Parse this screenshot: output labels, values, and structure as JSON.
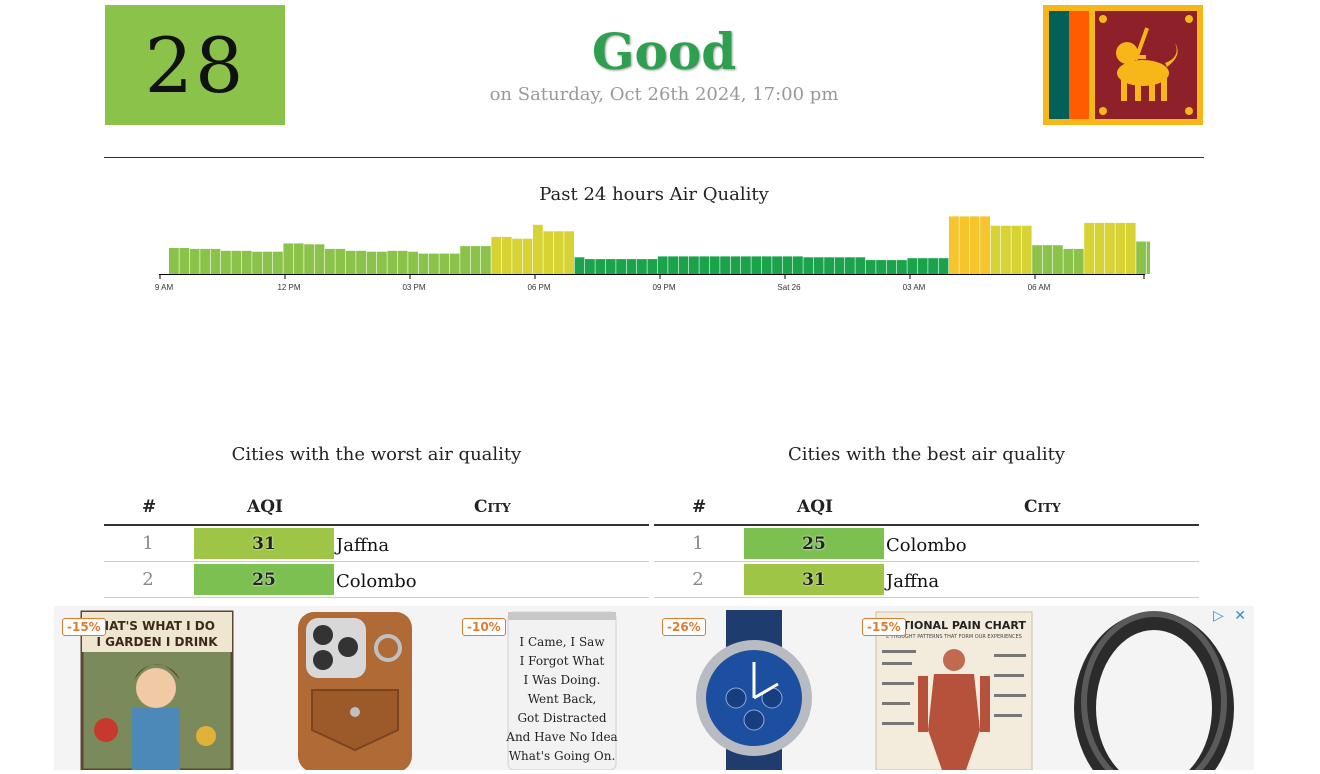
{
  "summary": {
    "aqi": "28",
    "status": "Good",
    "datetime": "on Saturday, Oct 26th 2024, 17:00 pm",
    "aqi_color": "#8bc34a",
    "status_color": "#2e9e4f"
  },
  "flag": {
    "country": "Sri Lanka"
  },
  "chart_section": {
    "title": "Past 24 hours Air Quality"
  },
  "chart_data": {
    "type": "bar",
    "title": "Past 24 hours Air Quality",
    "xtick_labels": [
      "9 AM",
      "12 PM",
      "03 PM",
      "06 PM",
      "09 PM",
      "Sat 26",
      "03 AM",
      "06 AM"
    ],
    "values": [
      28,
      28,
      27,
      27,
      27,
      25,
      25,
      25,
      24,
      24,
      24,
      33,
      33,
      32,
      32,
      27,
      27,
      25,
      25,
      24,
      24,
      25,
      25,
      24,
      22,
      22,
      22,
      22,
      30,
      30,
      30,
      40,
      40,
      38,
      38,
      53,
      46,
      46,
      46,
      18,
      16,
      16,
      16,
      16,
      16,
      16,
      16,
      19,
      19,
      19,
      19,
      19,
      19,
      19,
      19,
      19,
      19,
      19,
      19,
      19,
      19,
      18,
      18,
      18,
      18,
      18,
      18,
      15,
      15,
      15,
      15,
      17,
      17,
      17,
      17,
      62,
      62,
      62,
      62,
      52,
      52,
      52,
      52,
      31,
      31,
      31,
      27,
      27,
      55,
      55,
      55,
      55,
      55,
      35,
      35,
      35,
      35,
      30,
      33,
      33,
      33
    ],
    "bar_colors": {
      "low": "#1aa34a",
      "mid": "#8bc34a",
      "high": "#d8d334",
      "top": "#f7c42c"
    },
    "ylim": [
      0,
      70
    ]
  },
  "worst": {
    "title": "Cities with the worst air quality",
    "headers": {
      "rank": "#",
      "aqi": "AQI",
      "city": "City"
    },
    "rows": [
      {
        "rank": "1",
        "aqi": "31",
        "city": "Jaffna",
        "color": "#9ec545"
      },
      {
        "rank": "2",
        "aqi": "25",
        "city": "Colombo",
        "color": "#7cc052"
      }
    ]
  },
  "best": {
    "title": "Cities with the best air quality",
    "headers": {
      "rank": "#",
      "aqi": "AQI",
      "city": "City"
    },
    "rows": [
      {
        "rank": "1",
        "aqi": "25",
        "city": "Colombo",
        "color": "#7cc052"
      },
      {
        "rank": "2",
        "aqi": "31",
        "city": "Jaffna",
        "color": "#9ec545"
      }
    ]
  },
  "ads": {
    "controls": {
      "play": "▷",
      "close": "✕"
    },
    "items": [
      {
        "discount": "-15%",
        "name": "garden-drink-sign",
        "text": [
          "HAT'S WHAT I DO",
          "I GARDEN I DRINK"
        ]
      },
      {
        "discount": "",
        "name": "phone-wallet-case",
        "text": []
      },
      {
        "discount": "-10%",
        "name": "tumbler",
        "text": [
          "I Came, I Saw",
          "I Forgot What",
          "I Was Doing.",
          "Went Back,",
          "Got Distracted",
          "And Have No Idea",
          "What's Going On."
        ]
      },
      {
        "discount": "-26%",
        "name": "chronograph-watch",
        "text": []
      },
      {
        "discount": "-15%",
        "name": "emotional-pain-chart",
        "text": [
          "MOTIONAL PAIN CHART",
          "L THOUGHT PATTERNS THAT FORM OUR EXPERIENCES"
        ]
      },
      {
        "discount": "",
        "name": "silicone-ring",
        "text": []
      }
    ]
  }
}
